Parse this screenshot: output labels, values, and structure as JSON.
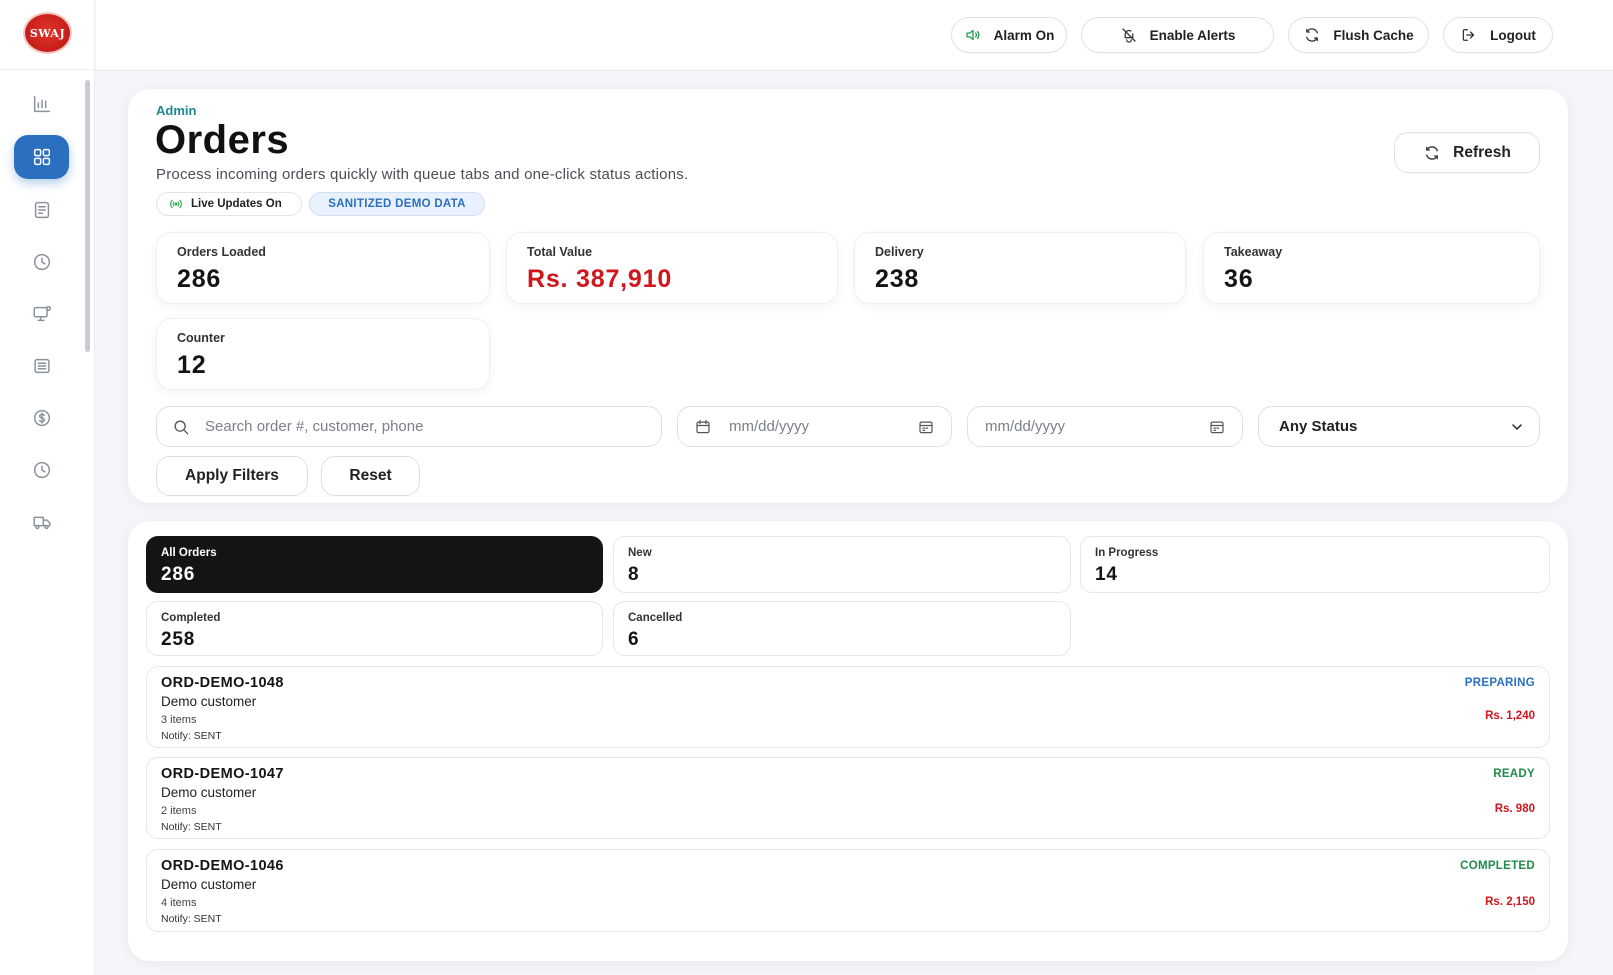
{
  "app": {
    "logo_text": "SWAJ"
  },
  "topbar": {
    "alarm_label": "Alarm On",
    "alerts_label": "Enable Alerts",
    "flush_label": "Flush Cache",
    "logout_label": "Logout"
  },
  "header": {
    "eyebrow": "Admin",
    "title": "Orders",
    "subtitle": "Process incoming orders quickly with queue tabs and one-click status actions.",
    "live_badge": "Live Updates On",
    "demo_badge": "SANITIZED DEMO DATA",
    "refresh_label": "Refresh"
  },
  "stats": [
    {
      "label": "Orders Loaded",
      "value": "286"
    },
    {
      "label": "Total Value",
      "value": "Rs. 387,910"
    },
    {
      "label": "Delivery",
      "value": "238"
    },
    {
      "label": "Takeaway",
      "value": "36"
    },
    {
      "label": "Counter",
      "value": "12"
    }
  ],
  "filters": {
    "search_placeholder": "Search order #, customer, phone",
    "date_from": "mm/dd/yyyy",
    "date_to": "mm/dd/yyyy",
    "status_value": "Any Status",
    "apply_label": "Apply Filters",
    "reset_label": "Reset"
  },
  "tabs": [
    {
      "label": "All Orders",
      "count": "286"
    },
    {
      "label": "New",
      "count": "8"
    },
    {
      "label": "In Progress",
      "count": "14"
    },
    {
      "label": "Completed",
      "count": "258"
    },
    {
      "label": "Cancelled",
      "count": "6"
    }
  ],
  "orders": [
    {
      "id": "ORD-DEMO-1048",
      "customer": "Demo customer",
      "items": "3 items",
      "notify": "Notify: SENT",
      "status": "PREPARING",
      "amount": "Rs. 1,240"
    },
    {
      "id": "ORD-DEMO-1047",
      "customer": "Demo customer",
      "items": "2 items",
      "notify": "Notify: SENT",
      "status": "READY",
      "amount": "Rs. 980"
    },
    {
      "id": "ORD-DEMO-1046",
      "customer": "Demo customer",
      "items": "4 items",
      "notify": "Notify: SENT",
      "status": "COMPLETED",
      "amount": "Rs. 2,150"
    }
  ],
  "colors": {
    "accent": "#2b6fc1",
    "eyebrow": "#1a8a8f",
    "money_red": "#d0161d",
    "status_preparing": "#2b6fc1",
    "status_ready": "#1f8a4c",
    "status_completed": "#1f8a4c"
  },
  "icons": {
    "sidebar": [
      "analytics-icon",
      "dashboard-grid-icon",
      "receipt-icon",
      "clock-icon",
      "monitor-user-icon",
      "list-icon",
      "dollar-icon",
      "history-icon",
      "delivery-truck-icon"
    ]
  }
}
